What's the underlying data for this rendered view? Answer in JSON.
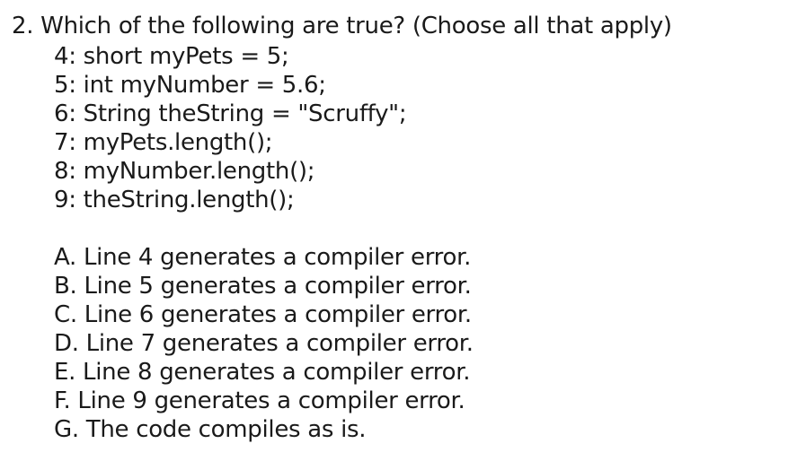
{
  "question": {
    "text": "2. Which of the following are true? (Choose all that apply)"
  },
  "code": [
    "4: short myPets = 5;",
    "5: int myNumber = 5.6;",
    "6: String theString = \"Scruffy\";",
    "7: myPets.length();",
    "8: myNumber.length();",
    "9: theString.length();"
  ],
  "options": [
    "A. Line 4 generates a compiler error.",
    "B. Line 5 generates a compiler error.",
    "C. Line 6 generates a compiler error.",
    "D. Line 7 generates a compiler error.",
    "E. Line 8 generates a compiler error.",
    "F. Line 9 generates a compiler error.",
    "G. The code compiles as is."
  ]
}
